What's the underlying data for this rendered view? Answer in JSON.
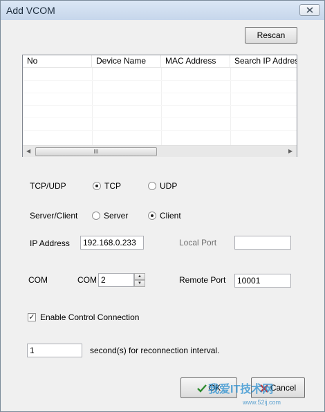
{
  "window": {
    "title": "Add VCOM"
  },
  "buttons": {
    "rescan": "Rescan",
    "ok": "OK",
    "cancel": "Cancel"
  },
  "list": {
    "columns": [
      "No",
      "Device Name",
      "MAC Address",
      "Search IP Address"
    ],
    "rows": []
  },
  "protocol": {
    "label": "TCP/UDP",
    "options": [
      "TCP",
      "UDP"
    ],
    "selected": "TCP"
  },
  "mode": {
    "label": "Server/Client",
    "options": [
      "Server",
      "Client"
    ],
    "selected": "Client"
  },
  "ip": {
    "label": "IP Address",
    "value": "192.168.0.233"
  },
  "local_port": {
    "label": "Local Port",
    "value": ""
  },
  "com": {
    "label": "COM",
    "prefix": "COM",
    "value": "2"
  },
  "remote_port": {
    "label": "Remote Port",
    "value": "10001"
  },
  "control_connection": {
    "label": "Enable Control Connection",
    "checked": true
  },
  "reconnect": {
    "value": "1",
    "suffix": "second(s) for reconnection interval."
  },
  "watermark": {
    "text": "我爱IT技术网",
    "url": "www.52ij.com"
  }
}
